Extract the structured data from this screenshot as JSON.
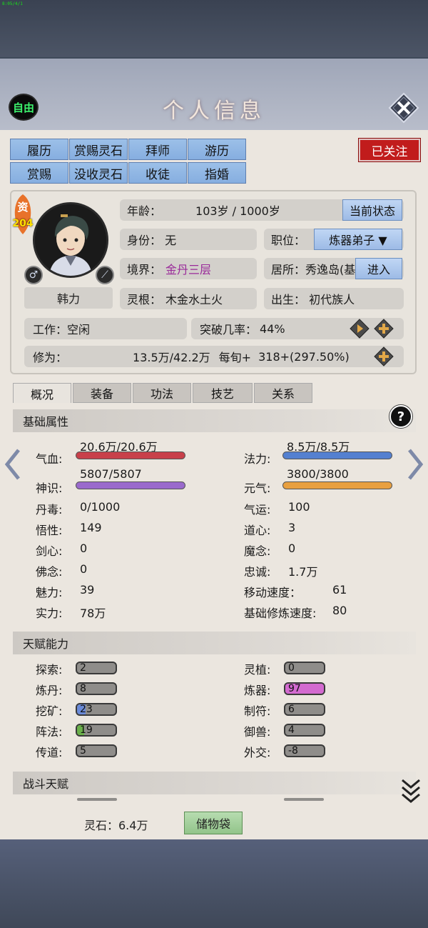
{
  "status_text": "8:05/4/1",
  "header": {
    "title": "个人信息",
    "free_label": "自由"
  },
  "actions": {
    "row1": [
      "履历",
      "赏赐灵石",
      "拜师",
      "游历"
    ],
    "row2": [
      "赏赐",
      "没收灵石",
      "收徒",
      "指婚"
    ],
    "follow_label": "已关注"
  },
  "profile": {
    "quality_char": "资",
    "quality_value": "204",
    "name": "韩力",
    "age_label": "年龄：",
    "age_value": "103岁 / 1000岁",
    "current_state_btn": "当前状态",
    "identity": "身份：  无",
    "position_label": "职位：",
    "position_value": "炼器弟子 ▼",
    "realm_label": "境界：",
    "realm_value": "金丹三层",
    "residence": "居所：秀逸岛(基",
    "enter_btn": "进入",
    "root_label": "灵根：",
    "root_value": "木金水土火",
    "birth": "出生：  初代族人",
    "work": "工作：空闲",
    "breakthrough_label": "突破几率：",
    "breakthrough_value": "44%",
    "cultivation_label": "修为：",
    "cultivation_value": "13.5万/42.2万",
    "per_turn_label": "每旬+",
    "per_turn_value": "318+(297.50%)"
  },
  "subtabs": [
    "概况",
    "装备",
    "功法",
    "技艺",
    "关系"
  ],
  "basic": {
    "heading": "基础属性",
    "hp_label": "气血:",
    "hp_value": "20.6万/20.6万",
    "hp_fill": 1.0,
    "mana_label": "法力:",
    "mana_value": "8.5万/8.5万",
    "mana_fill": 1.0,
    "sense_label": "神识:",
    "sense_value": "5807/5807",
    "sense_fill": 1.0,
    "vital_label": "元气:",
    "vital_value": "3800/3800",
    "vital_fill": 1.0,
    "stats": [
      {
        "label": "丹毒:",
        "value": "0/1000",
        "label2": "气运:",
        "value2": "100"
      },
      {
        "label": "悟性:",
        "value": "149",
        "label2": "道心:",
        "value2": "3"
      },
      {
        "label": "剑心:",
        "value": "0",
        "label2": "魔念:",
        "value2": "0"
      },
      {
        "label": "佛念:",
        "value": "0",
        "label2": "忠诚:",
        "value2": "1.7万"
      },
      {
        "label": "魅力:",
        "value": "39",
        "label2": "移动速度：",
        "value2": "61"
      },
      {
        "label": "实力:",
        "value": "78万",
        "label2": "基础修炼速度:",
        "value2": "80"
      }
    ]
  },
  "talent": {
    "heading": "天赋能力",
    "rows": [
      {
        "label": "探索:",
        "value": "2",
        "label2": "灵植:",
        "value2": "0"
      },
      {
        "label": "炼丹:",
        "value": "8",
        "label2": "炼器:",
        "value2": "97"
      },
      {
        "label": "挖矿:",
        "value": "23",
        "label2": "制符:",
        "value2": "6"
      },
      {
        "label": "阵法:",
        "value": "19",
        "label2": "御兽:",
        "value2": "4"
      },
      {
        "label": "传道:",
        "value": "5",
        "label2": "外交:",
        "value2": "-8"
      }
    ]
  },
  "combat": {
    "heading": "战斗天赋"
  },
  "footer": {
    "spirit_stone": "灵石：6.4万",
    "bag_btn": "储物袋"
  },
  "colors": {
    "hp": "#c8404a",
    "mana": "#5480d0",
    "sense": "#9a6acc",
    "vital": "#e8a040",
    "talent_high": "#d36ad0",
    "talent_mid_blue": "#6a8ad8",
    "talent_mid_green": "#6ab04a"
  }
}
